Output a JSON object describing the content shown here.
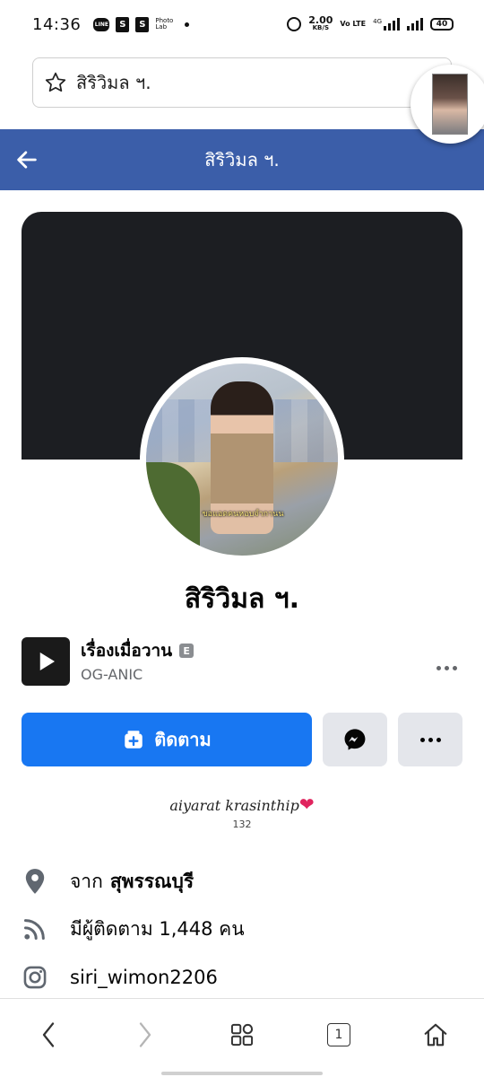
{
  "status_bar": {
    "time": "14:36",
    "line_label": "LINE",
    "shop_label": "S",
    "photo_lab_label": "Photo Lab",
    "net_speed": "2.00",
    "net_speed_unit": "KB/S",
    "volte_label": "Vo LTE",
    "network_type": "4G",
    "battery": "40"
  },
  "browser": {
    "search_text": "สิริวิมล ฯ.",
    "star_icon": "star-outline-icon"
  },
  "app_bar": {
    "title": "สิริวิมล ฯ.",
    "color": "#3b5ea9"
  },
  "profile": {
    "name": "สิริวิมล ฯ.",
    "photo_caption": "ขอแอดคนหอบจำกานน"
  },
  "music": {
    "title": "เรื่องเมื่อวาน",
    "explicit_badge": "E",
    "artist": "OG-ANIC"
  },
  "actions": {
    "follow_label": "ติดตาม",
    "follow_color": "#1877f2"
  },
  "bio": {
    "text": "aiyarat krasinthip",
    "heart": "❤",
    "count": "132"
  },
  "details": {
    "from_prefix": "จาก",
    "from_place": "สุพรรณบุรี",
    "followers": "มีผู้ติดตาม 1,448 คน",
    "instagram": "siri_wimon2206"
  },
  "bottom_nav": {
    "tabs_count": "1"
  }
}
